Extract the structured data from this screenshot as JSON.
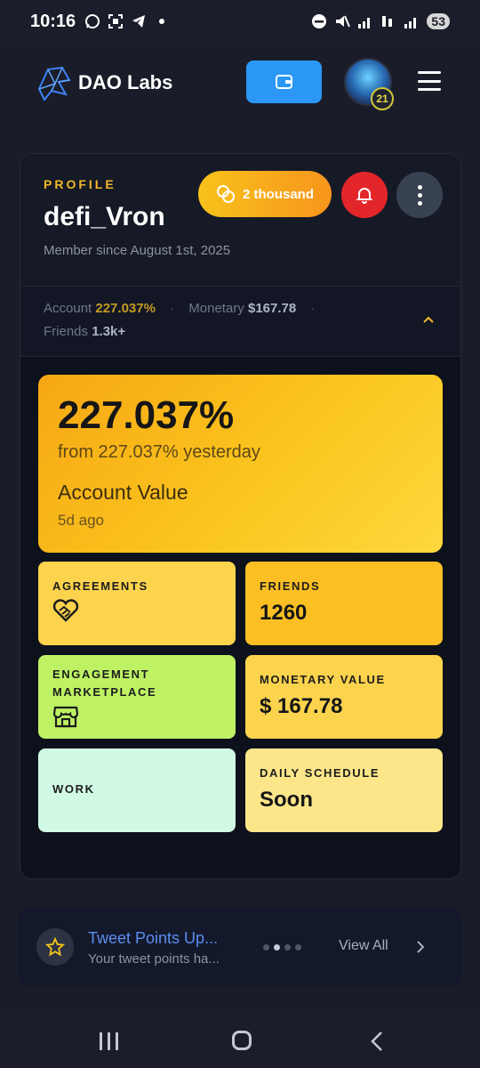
{
  "status_bar": {
    "time": "10:16",
    "battery": "53"
  },
  "header": {
    "brand": "DAO Labs",
    "avatar_level": "21"
  },
  "profile": {
    "section_label": "PROFILE",
    "username": "defi_Vron",
    "member_since": "Member since August 1st, 2025",
    "points_label": "2 thousand",
    "stats": {
      "account_label": "Account",
      "account_value": "227.037%",
      "monetary_label": "Monetary",
      "monetary_value": "$167.78",
      "friends_label": "Friends",
      "friends_value": "1.3k+"
    }
  },
  "account_card": {
    "value": "227.037%",
    "sub": "from 227.037% yesterday",
    "label": "Account Value",
    "ago": "5d ago"
  },
  "tiles": {
    "agreements": {
      "label": "AGREEMENTS",
      "color": "#fcd34d"
    },
    "friends": {
      "label": "FRIENDS",
      "value": "1260",
      "color": "#fbbf24"
    },
    "engagement": {
      "label_line1": "ENGAGEMENT",
      "label_line2": "MARKETPLACE",
      "color": "#bef264"
    },
    "monetary": {
      "label": "MONETARY VALUE",
      "value": "$ 167.78",
      "color": "#fcd34d"
    },
    "work": {
      "label": "WORK",
      "color": "#d1fae5"
    },
    "daily": {
      "label": "DAILY SCHEDULE",
      "value": "Soon",
      "color": "#fde68a"
    }
  },
  "announcement": {
    "title": "Tweet Points Up...",
    "subtitle": "Your tweet points ha...",
    "view_all": "View All",
    "active_dot": 1,
    "dot_count": 4
  },
  "colors": {
    "accent_blue": "#2b97f6",
    "bell_red": "#e3262a",
    "profile_gold": "#f1b82a"
  }
}
